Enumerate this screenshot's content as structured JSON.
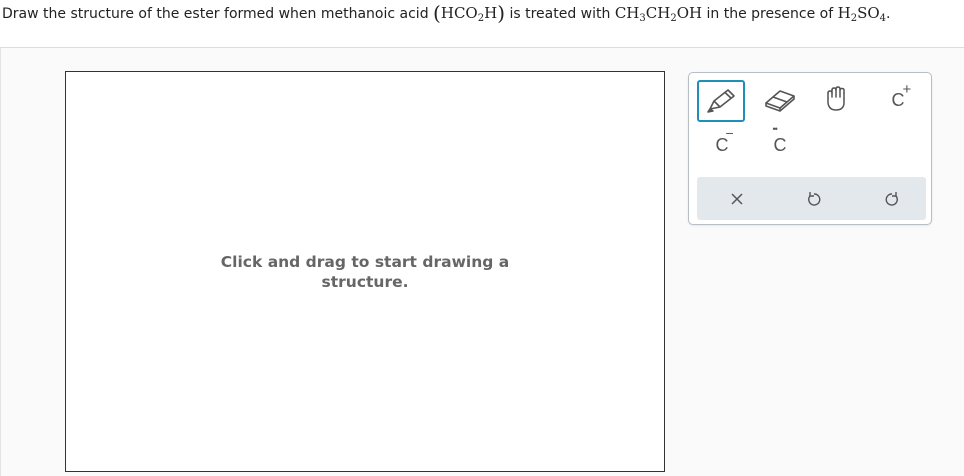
{
  "question": {
    "text_1": "Draw the structure of the ester formed when methanoic acid ",
    "paren_open": "(",
    "acid_a": "HCO",
    "acid_sub": "2",
    "acid_b": "H",
    "paren_close": ")",
    "text_2": " is treated with ",
    "ethanol_a": "CH",
    "ethanol_sub1": "3",
    "ethanol_b": "CH",
    "ethanol_sub2": "2",
    "ethanol_c": "OH",
    "text_3": " in the presence of ",
    "catalyst_a": "H",
    "catalyst_sub1": "2",
    "catalyst_b": "SO",
    "catalyst_sub2": "4",
    "text_4": "."
  },
  "canvas": {
    "hint_line1": "Click and drag to start drawing a",
    "hint_line2": "structure."
  },
  "toolbox": {
    "tools": [
      {
        "name": "pencil-icon"
      },
      {
        "name": "eraser-icon"
      },
      {
        "name": "hand-move-icon"
      },
      {
        "name": "positive-charge",
        "letter": "C",
        "mark": "+"
      },
      {
        "name": "negative-charge",
        "letter": "C",
        "mark": "−"
      },
      {
        "name": "lone-pair",
        "letter": "C",
        "mark": "••"
      }
    ],
    "actions": [
      {
        "name": "clear-icon"
      },
      {
        "name": "undo-icon"
      },
      {
        "name": "redo-icon"
      }
    ],
    "colors": {
      "selected_border": "#1f8fb8",
      "action_bar": "#e3e8ed",
      "icon": "#555555"
    }
  }
}
